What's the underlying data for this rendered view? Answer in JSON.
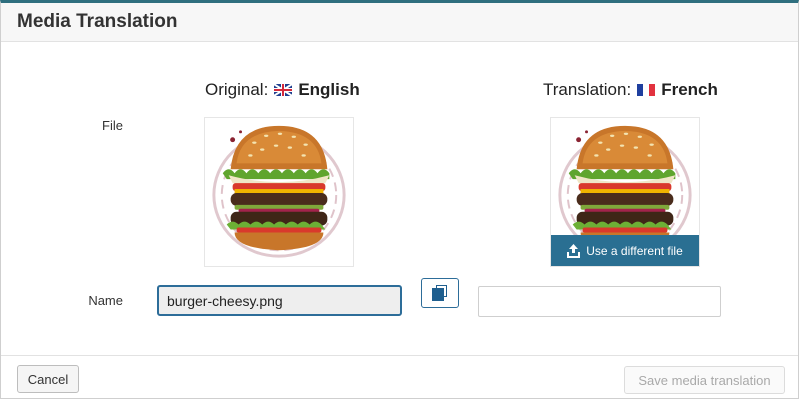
{
  "dialog": {
    "title": "Media Translation"
  },
  "original": {
    "heading_prefix": "Original:",
    "language": "English",
    "flag_icon": "uk-flag-icon",
    "image_alt": "burger image",
    "name_value": "burger-cheesy.png"
  },
  "translation": {
    "heading_prefix": "Translation:",
    "language": "French",
    "flag_icon": "fr-flag-icon",
    "upload_label": "Use a different file",
    "name_value": "",
    "name_placeholder": ""
  },
  "rows": {
    "file_label": "File",
    "name_label": "Name"
  },
  "actions": {
    "copy_icon": "copy-icon",
    "cancel_label": "Cancel",
    "save_label": "Save media translation"
  },
  "colors": {
    "accent": "#2a6f92",
    "header_border": "#2f6f7f"
  }
}
